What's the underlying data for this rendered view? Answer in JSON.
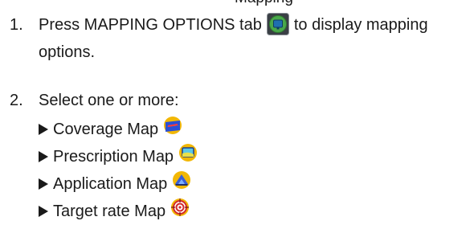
{
  "header_fragment": "Mapping",
  "steps": [
    {
      "number": "1.",
      "text_before": "Press MAPPING OPTIONS tab",
      "text_after": "to display mapping",
      "continuation": "options.",
      "icon": "mapping-options-tab-icon"
    },
    {
      "number": "2.",
      "text": "Select one or more:"
    }
  ],
  "options": [
    {
      "label": "Coverage Map",
      "icon": "coverage-map-icon"
    },
    {
      "label": "Prescription Map",
      "icon": "prescription-map-icon"
    },
    {
      "label": "Application Map",
      "icon": "application-map-icon"
    },
    {
      "label": "Target rate Map",
      "icon": "target-rate-map-icon"
    }
  ]
}
